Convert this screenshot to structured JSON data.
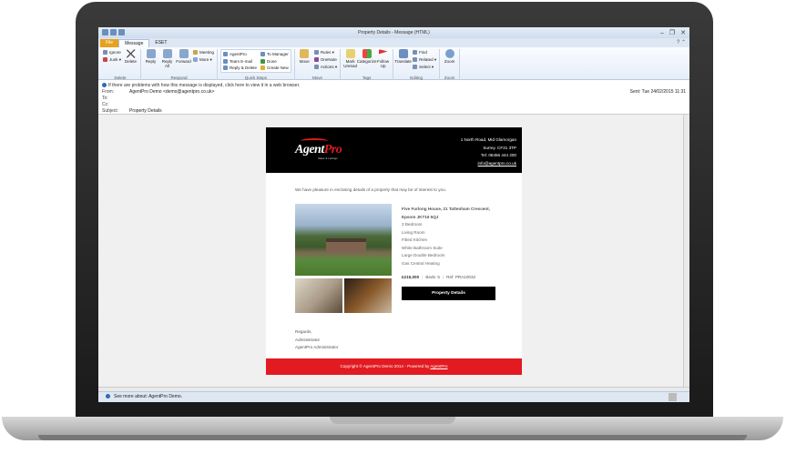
{
  "window": {
    "title": "Property Details - Message (HTML)",
    "controls": [
      "–",
      "❐",
      "✕"
    ]
  },
  "tabs": [
    {
      "label": "File"
    },
    {
      "label": "Message"
    },
    {
      "label": "ESET"
    }
  ],
  "ribbon": {
    "delete": {
      "label": "Delete",
      "ignore": "Ignore",
      "junk": "Junk ▾",
      "delete": "Delete"
    },
    "respond": {
      "label": "Respond",
      "reply": "Reply",
      "reply_all": "Reply All",
      "forward": "Forward",
      "meeting": "Meeting",
      "more": "More ▾"
    },
    "quick_steps": {
      "label": "Quick Steps",
      "items": [
        "AgentPro",
        "Team E-mail",
        "Reply & Delete",
        "To Manager",
        "Done",
        "Create New"
      ]
    },
    "move": {
      "label": "Move",
      "move": "Move",
      "rules": "Rules ▾",
      "onenote": "OneNote",
      "actions": "Actions ▾"
    },
    "tags": {
      "label": "Tags",
      "mark_unread": "Mark Unread",
      "categorize": "Categorize",
      "follow_up": "Follow Up"
    },
    "editing": {
      "label": "Editing",
      "translate": "Translate",
      "find": "Find",
      "related": "Related ▾",
      "select": "Select ▾"
    },
    "zoom": {
      "label": "Zoom",
      "zoom": "Zoom"
    }
  },
  "header": {
    "info": "If there are problems with how this message is displayed, click here to view it in a web browser.",
    "from_label": "From:",
    "from": "AgentPro Demo <demo@agentpro.co.uk>",
    "to_label": "To:",
    "cc_label": "Cc:",
    "subject_label": "Subject:",
    "subject": "Property Details",
    "sent_label": "Sent:",
    "sent": "Tue 24/02/2015 11:31"
  },
  "email": {
    "logo": {
      "agent": "Agent",
      "pro": "Pro",
      "tagline": "Sales & Lettings"
    },
    "address": [
      "1 North Road, Mid Glamorgan",
      "Surrey. CF31 3TP",
      "Tel: 08456 444 200",
      "info@agentpro.co.uk"
    ],
    "intro": "We have pleasure in enclosing details of a property that may be of interest to you.",
    "property": {
      "title1": "Five Furlong House, 21 Tattenham Crescent,",
      "title2": "Epsom JKT16 5QJ",
      "features": [
        "3 Bedroom",
        "Living Room",
        "Fitted Kitchen",
        "White Bathroom Suite",
        "Large Double Bedroom",
        "Gas Central Heating"
      ],
      "price": "£215,000",
      "beds": "Beds: 5",
      "ref": "Ref: PRA10032",
      "button": "Property Details"
    },
    "regards": [
      "Regards,",
      "Administrator",
      "AgentPro Administrator"
    ],
    "footer": {
      "text": "Copyright © AgentPro Demo 2014 - Powered by ",
      "link": "AgentPro"
    }
  },
  "status": {
    "text": "See more about: AgentPro Demo."
  },
  "colors": {
    "brand_red": "#e21a22",
    "file_tab": "#e8a11c"
  }
}
